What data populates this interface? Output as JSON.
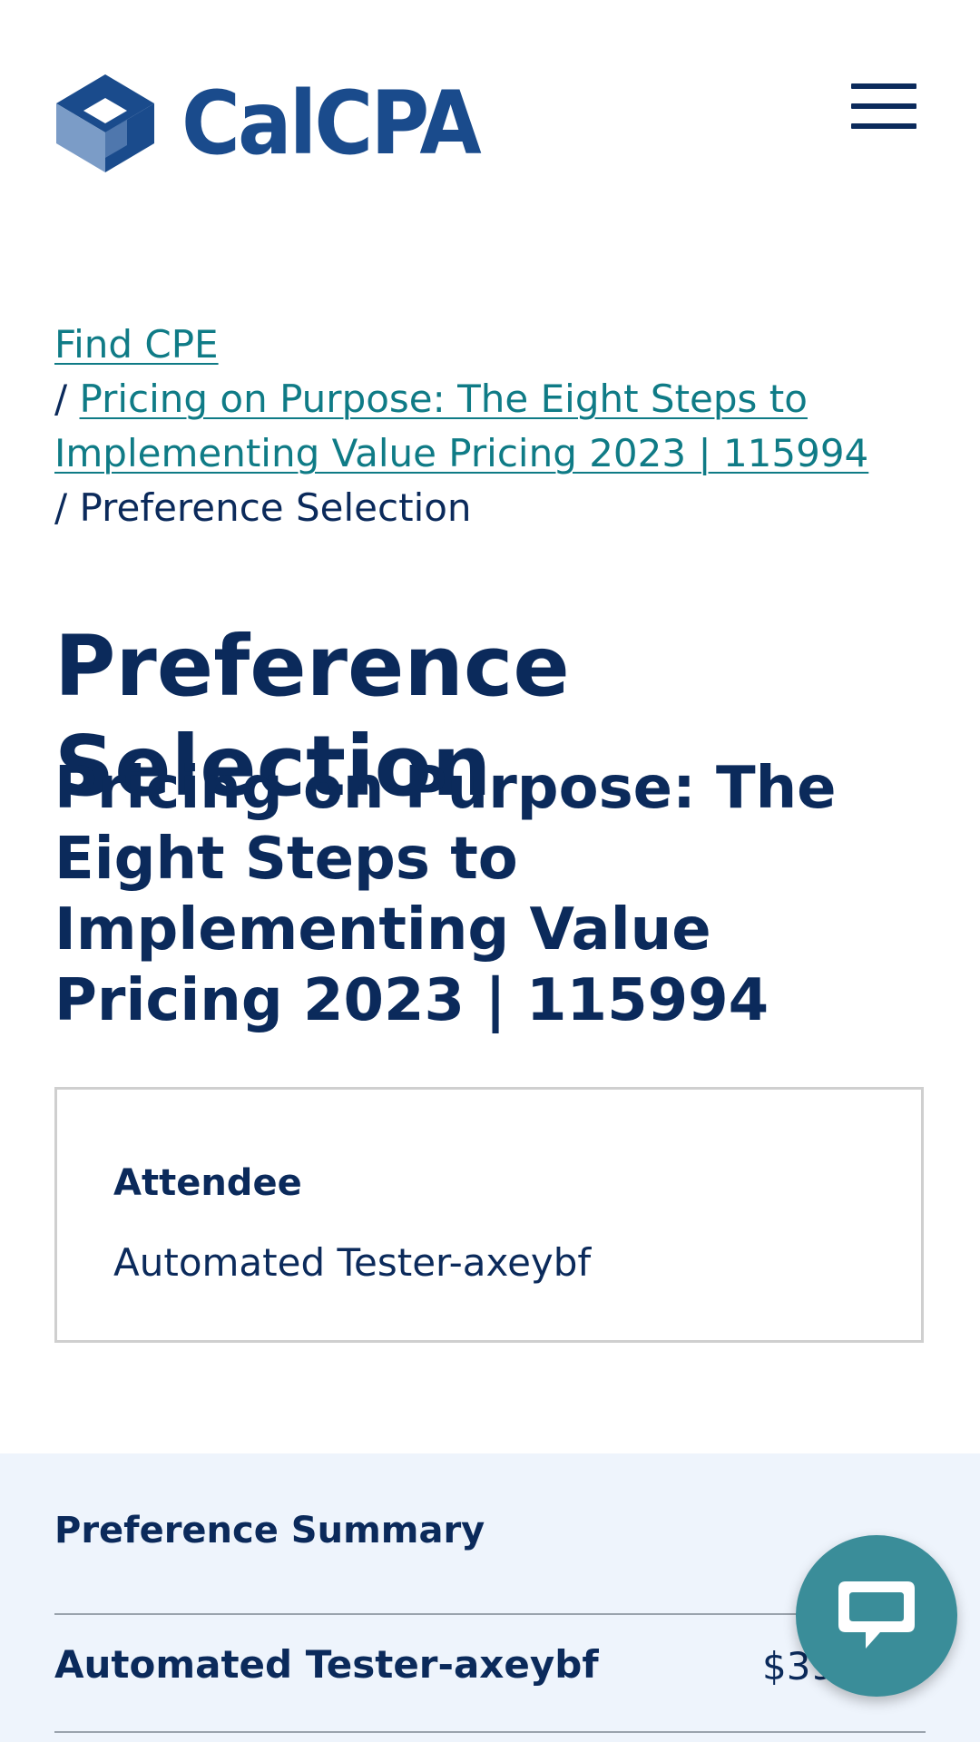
{
  "header": {
    "logo_text": "CalCPA",
    "menu_icon": "hamburger-menu-icon",
    "brand_color": "#1a4b8c"
  },
  "breadcrumb": {
    "items": [
      {
        "label": "Find CPE"
      },
      {
        "label": "Pricing on Purpose: The Eight Steps to Implementing Value Pricing 2023 | 115994"
      },
      {
        "label": "Preference Selection"
      }
    ],
    "separator": "/",
    "link_color": "#0f7b86"
  },
  "main": {
    "page_title": "Preference Selection",
    "course_title": "Pricing on Purpose: The Eight Steps to Implementing Value Pricing 2023 | 115994",
    "attendee": {
      "label": "Attendee",
      "name": "Automated Tester-axeybf"
    }
  },
  "summary": {
    "title": "Preference Summary",
    "rows": [
      {
        "name": "Automated Tester-axeybf",
        "price": "$39"
      }
    ],
    "background": "#eef4fc"
  },
  "chat": {
    "icon": "chat-bubble-icon",
    "color": "#3a8d99"
  }
}
